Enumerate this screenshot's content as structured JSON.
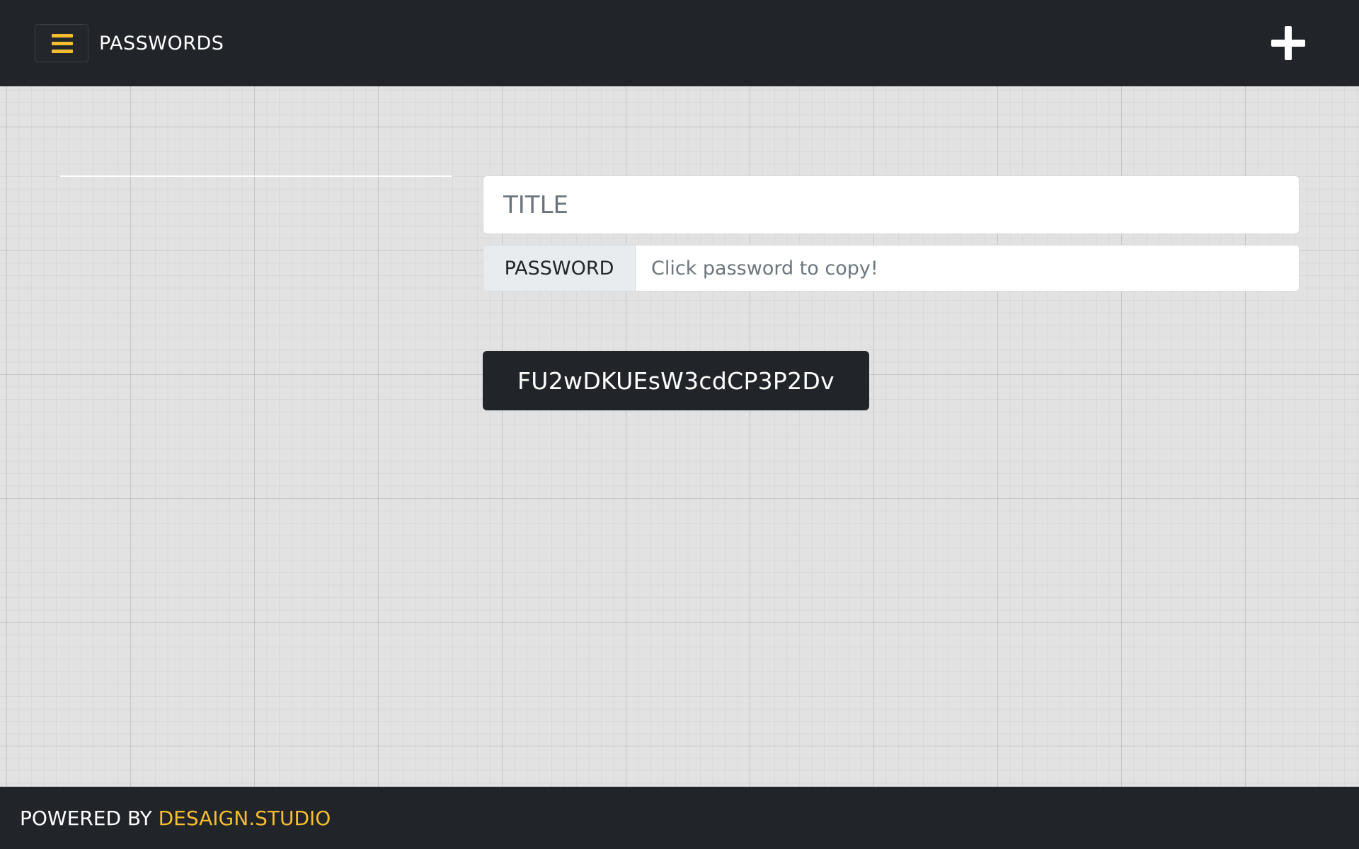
{
  "header": {
    "menu_icon": "hamburger-menu-icon",
    "title": "PASSWORDS",
    "add_icon": "plus-icon"
  },
  "form": {
    "title_placeholder": "TITLE",
    "title_value": "",
    "password_label": "PASSWORD",
    "password_placeholder": "Click password to copy!",
    "password_value": ""
  },
  "generated_password": "FU2wDKUEsW3cdCP3P2Dv",
  "footer": {
    "powered_by": "POWERED BY ",
    "brand_link": "DESAIGN.STUDIO"
  },
  "colors": {
    "header_bg": "#212429",
    "accent": "#f5be2e",
    "page_bg": "#e2e2e2"
  }
}
